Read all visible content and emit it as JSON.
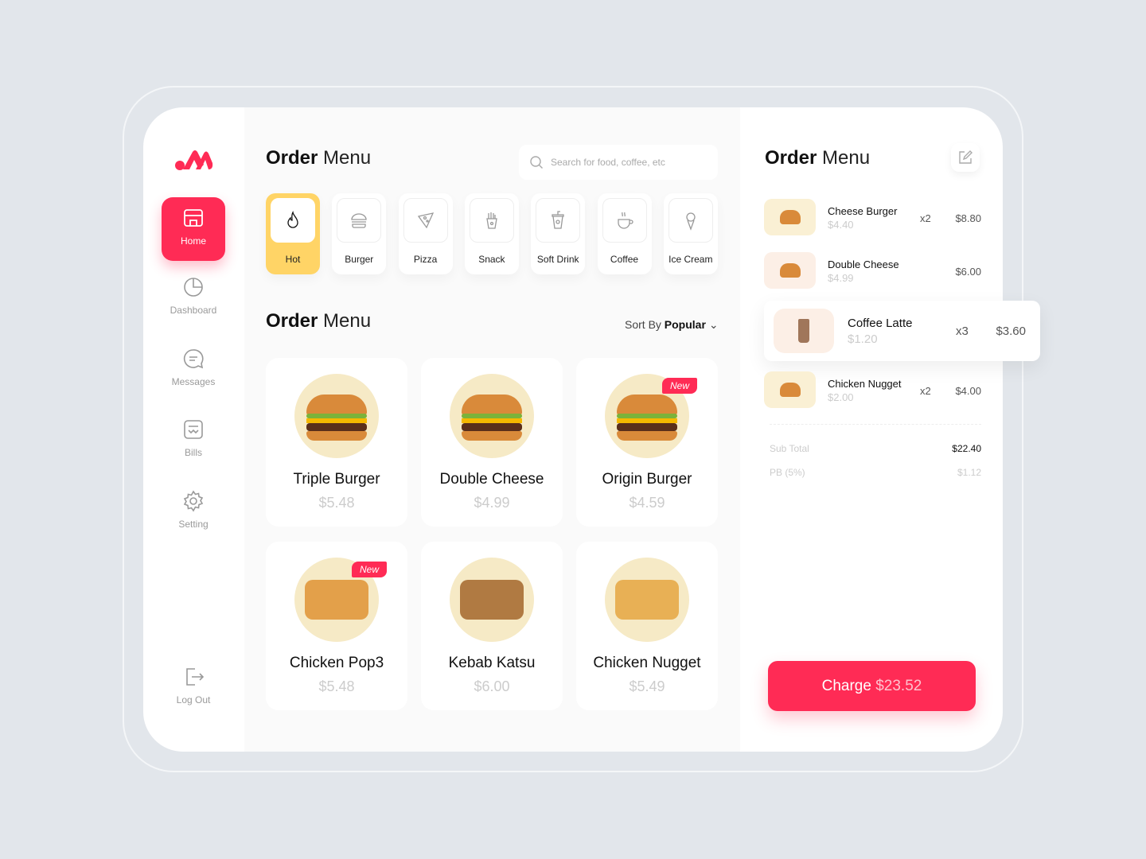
{
  "colors": {
    "accent": "#ff2b55",
    "active_category": "#ffd466"
  },
  "sidebar": {
    "items": [
      {
        "label": "Home",
        "icon": "store-icon"
      },
      {
        "label": "Dashboard",
        "icon": "pie-chart-icon"
      },
      {
        "label": "Messages",
        "icon": "chat-icon"
      },
      {
        "label": "Bills",
        "icon": "receipt-icon"
      },
      {
        "label": "Setting",
        "icon": "gear-icon"
      }
    ],
    "logout": "Log Out"
  },
  "main": {
    "title_bold": "Order",
    "title_rest": "Menu",
    "search_placeholder": "Search for food, coffee, etc",
    "categories": [
      {
        "label": "Hot",
        "icon": "flame-icon"
      },
      {
        "label": "Burger",
        "icon": "burger-icon"
      },
      {
        "label": "Pizza",
        "icon": "pizza-icon"
      },
      {
        "label": "Snack",
        "icon": "fries-icon"
      },
      {
        "label": "Soft Drink",
        "icon": "drink-icon"
      },
      {
        "label": "Coffee",
        "icon": "coffee-icon"
      },
      {
        "label": "Ice Cream",
        "icon": "ice-cream-icon"
      }
    ],
    "section_bold": "Order",
    "section_rest": "Menu",
    "sort_label": "Sort By",
    "sort_value": "Popular",
    "foods": [
      {
        "name": "Triple Burger",
        "price": "$5.48"
      },
      {
        "name": "Double Cheese",
        "price": "$4.99"
      },
      {
        "name": "Origin Burger",
        "price": "$4.59",
        "badge": "New"
      },
      {
        "name": "Chicken Pop3",
        "price": "$5.48",
        "badge": "New"
      },
      {
        "name": "Kebab Katsu",
        "price": "$6.00"
      },
      {
        "name": "Chicken Nugget",
        "price": "$5.49"
      }
    ]
  },
  "order": {
    "title_bold": "Order",
    "title_rest": "Menu",
    "items": [
      {
        "name": "Cheese Burger",
        "price": "$4.40",
        "qty": "x2",
        "total": "$8.80"
      },
      {
        "name": "Double Cheese",
        "price": "$4.99",
        "qty": "",
        "total": "$6.00"
      },
      {
        "name": "Coffee Latte",
        "price": "$1.20",
        "qty": "x3",
        "total": "$3.60"
      },
      {
        "name": "Chicken Nugget",
        "price": "$2.00",
        "qty": "x2",
        "total": "$4.00"
      }
    ],
    "subtotal_label": "Sub Total",
    "subtotal": "$22.40",
    "tax_label": "PB (5%)",
    "tax": "$1.12",
    "charge_label": "Charge",
    "charge_amount": "$23.52"
  }
}
